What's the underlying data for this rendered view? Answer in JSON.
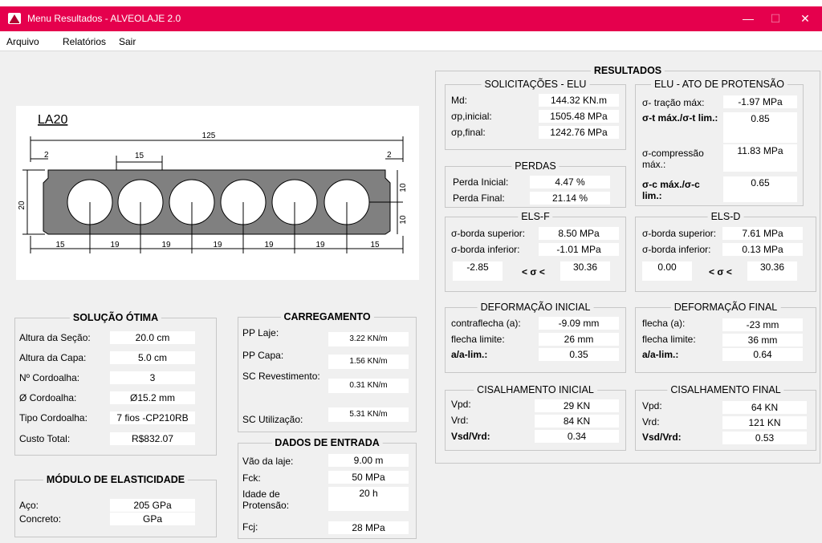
{
  "window": {
    "title": "Menu Resultados - ALVEOLAJE 2.0",
    "minimize_label": "—",
    "maximize_label": "☐",
    "close_label": "✕"
  },
  "menu": {
    "items": [
      "Arquivo",
      "Relatórios",
      "Sair"
    ]
  },
  "drawing": {
    "section_name": "LA20",
    "width_total": "125",
    "flange_left": "2",
    "flange_right": "2",
    "void_pitch": "15",
    "height": "20",
    "right_top": "10",
    "right_bottom": "10",
    "bottom_dims": [
      "15",
      "19",
      "19",
      "19",
      "19",
      "19",
      "15"
    ]
  },
  "solucao": {
    "title": "SOLUÇÃO ÓTIMA",
    "rows": [
      {
        "label": "Altura da Seção:",
        "value": "20.0 cm"
      },
      {
        "label": "Altura da Capa:",
        "value": "5.0 cm"
      },
      {
        "label": "Nº Cordoalha:",
        "value": "3"
      },
      {
        "label": "Ø Cordoalha:",
        "value": "Ø15.2 mm"
      },
      {
        "label": "Tipo Cordoalha:",
        "value": "7 fios -CP210RB"
      },
      {
        "label": "Custo Total:",
        "value": "R$832.07"
      }
    ]
  },
  "modulo": {
    "title": "MÓDULO DE ELASTICIDADE",
    "rows": [
      {
        "label": "Aço:",
        "value": "205 GPa"
      },
      {
        "label": "Concreto:",
        "value": "GPa"
      }
    ]
  },
  "carregamento": {
    "title": "CARREGAMENTO",
    "rows": [
      {
        "label": "PP Laje:",
        "value": "3.22 KN/m"
      },
      {
        "label": "PP Capa:",
        "value": "1.56 KN/m"
      },
      {
        "label": "SC Revestimento:",
        "value": "0.31 KN/m"
      },
      {
        "label": "SC Utilização:",
        "value": "5.31 KN/m"
      }
    ]
  },
  "dados": {
    "title": "DADOS DE ENTRADA",
    "rows": [
      {
        "label": "Vão da laje:",
        "value": "9.00 m"
      },
      {
        "label": "Fck:",
        "value": "50 MPa"
      },
      {
        "label": "Idade de Protensão:",
        "value": "20 h"
      },
      {
        "label": "Fcj:",
        "value": "28 MPa"
      }
    ]
  },
  "resultados": {
    "title": "RESULTADOS",
    "elu": {
      "title": "SOLICITAÇÕES - ELU",
      "rows": [
        {
          "label": "Md:",
          "value": "144.32 KN.m"
        },
        {
          "label": "σp,inicial:",
          "value": "1505.48 MPa"
        },
        {
          "label": "σp,final:",
          "value": "1242.76 MPa"
        }
      ]
    },
    "ato": {
      "title": "ELU - ATO DE PROTENSÃO",
      "tracao_label": "σ- tração máx:",
      "tracao_value": "-1.97 MPa",
      "ratio_t_label": "σ-t máx./σ-t lim.:",
      "ratio_t_value": "0.85",
      "comp_label": "σ-compressão máx.:",
      "comp_value": "11.83 MPa",
      "ratio_c_label": "σ-c máx./σ-c lim.:",
      "ratio_c_value": "0.65"
    },
    "perdas": {
      "title": "PERDAS",
      "rows": [
        {
          "label": "Perda Inicial:",
          "value": "4.47 %"
        },
        {
          "label": "Perda Final:",
          "value": "21.14 %"
        }
      ]
    },
    "elsf": {
      "title": "ELS-F",
      "rows": [
        {
          "label": "σ-borda superior:",
          "value": "8.50 MPa"
        },
        {
          "label": "σ-borda inferior:",
          "value": "-1.01 MPa"
        }
      ],
      "min": "-2.85",
      "between": "< σ <",
      "max": "30.36"
    },
    "elsd": {
      "title": "ELS-D",
      "rows": [
        {
          "label": "σ-borda superior:",
          "value": "7.61 MPa"
        },
        {
          "label": "σ-borda inferior:",
          "value": "0.13 MPa"
        }
      ],
      "min": "0.00",
      "between": "< σ <",
      "max": "30.36"
    },
    "def_ini": {
      "title": "DEFORMAÇÃO INICIAL",
      "rows": [
        {
          "label": "contraflecha (a):",
          "value": "-9.09 mm"
        },
        {
          "label": "flecha limite:",
          "value": "26 mm"
        },
        {
          "label": "a/a-lim.:",
          "value": "0.35"
        }
      ]
    },
    "def_fin": {
      "title": "DEFORMAÇÃO FINAL",
      "rows": [
        {
          "label": "flecha (a):",
          "value": "-23 mm"
        },
        {
          "label": "flecha limite:",
          "value": "36 mm"
        },
        {
          "label": "a/a-lim.:",
          "value": "0.64"
        }
      ]
    },
    "cis_ini": {
      "title": "CISALHAMENTO INICIAL",
      "rows": [
        {
          "label": "Vpd:",
          "value": "29 KN"
        },
        {
          "label": "Vrd:",
          "value": "84 KN"
        },
        {
          "label": "Vsd/Vrd:",
          "value": "0.34"
        }
      ]
    },
    "cis_fin": {
      "title": "CISALHAMENTO FINAL",
      "rows": [
        {
          "label": "Vpd:",
          "value": "64 KN"
        },
        {
          "label": "Vrd:",
          "value": "121 KN"
        },
        {
          "label": "Vsd/Vrd:",
          "value": "0.53"
        }
      ]
    }
  }
}
